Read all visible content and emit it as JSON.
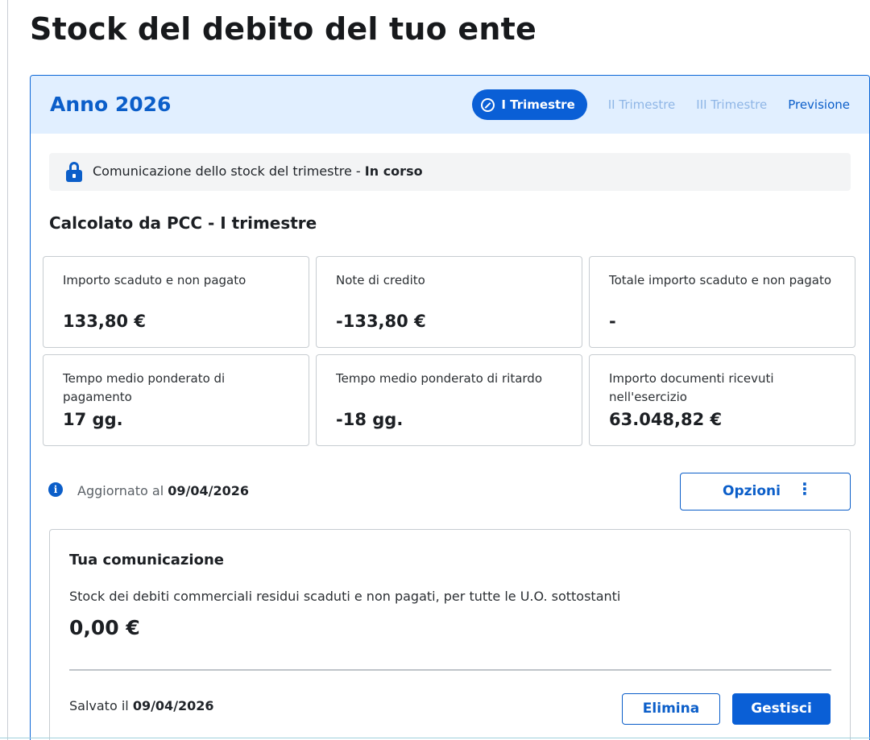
{
  "page": {
    "title": "Stock del debito del tuo ente"
  },
  "card": {
    "year": "Anno 2026",
    "tabs": [
      {
        "label": "I Trimestre",
        "state": "active"
      },
      {
        "label": "II Trimestre",
        "state": "disabled"
      },
      {
        "label": "III Trimestre",
        "state": "disabled"
      },
      {
        "label": "Previsione",
        "state": "enabled"
      }
    ]
  },
  "status": {
    "icon": "lock-icon",
    "text": "Comunicazione dello stock del trimestre - ",
    "state": "In corso"
  },
  "section": {
    "title": "Calcolato da PCC - I trimestre"
  },
  "metrics": [
    {
      "label": "Importo scaduto e non pagato",
      "value": "133,80 €"
    },
    {
      "label": "Note di credito",
      "value": "-133,80 €"
    },
    {
      "label": "Totale importo scaduto e non pagato",
      "value": "-"
    },
    {
      "label": "Tempo medio ponderato di pagamento",
      "value": "17 gg."
    },
    {
      "label": "Tempo medio ponderato di ritardo",
      "value": "-18 gg."
    },
    {
      "label": "Importo documenti ricevuti nell'esercizio",
      "value": "63.048,82 €"
    }
  ],
  "update": {
    "prefix": "Aggiornato al",
    "date": "09/04/2026",
    "icon": "info-icon"
  },
  "options_button": {
    "label": "Opzioni",
    "icon": "vertical-dots-icon"
  },
  "communication": {
    "heading": "Tua comunicazione",
    "description": "Stock dei debiti commerciali residui scaduti e non pagati, per tutte le U.O. sottostanti",
    "amount": "0,00 €",
    "saved_prefix": "Salvato il",
    "saved_date": "09/04/2026",
    "delete_label": "Elimina",
    "manage_label": "Gestisci"
  },
  "colors": {
    "primary": "#0a5fd6",
    "header_bg": "#e1efff",
    "disabled_tab": "#8fb6e6"
  }
}
